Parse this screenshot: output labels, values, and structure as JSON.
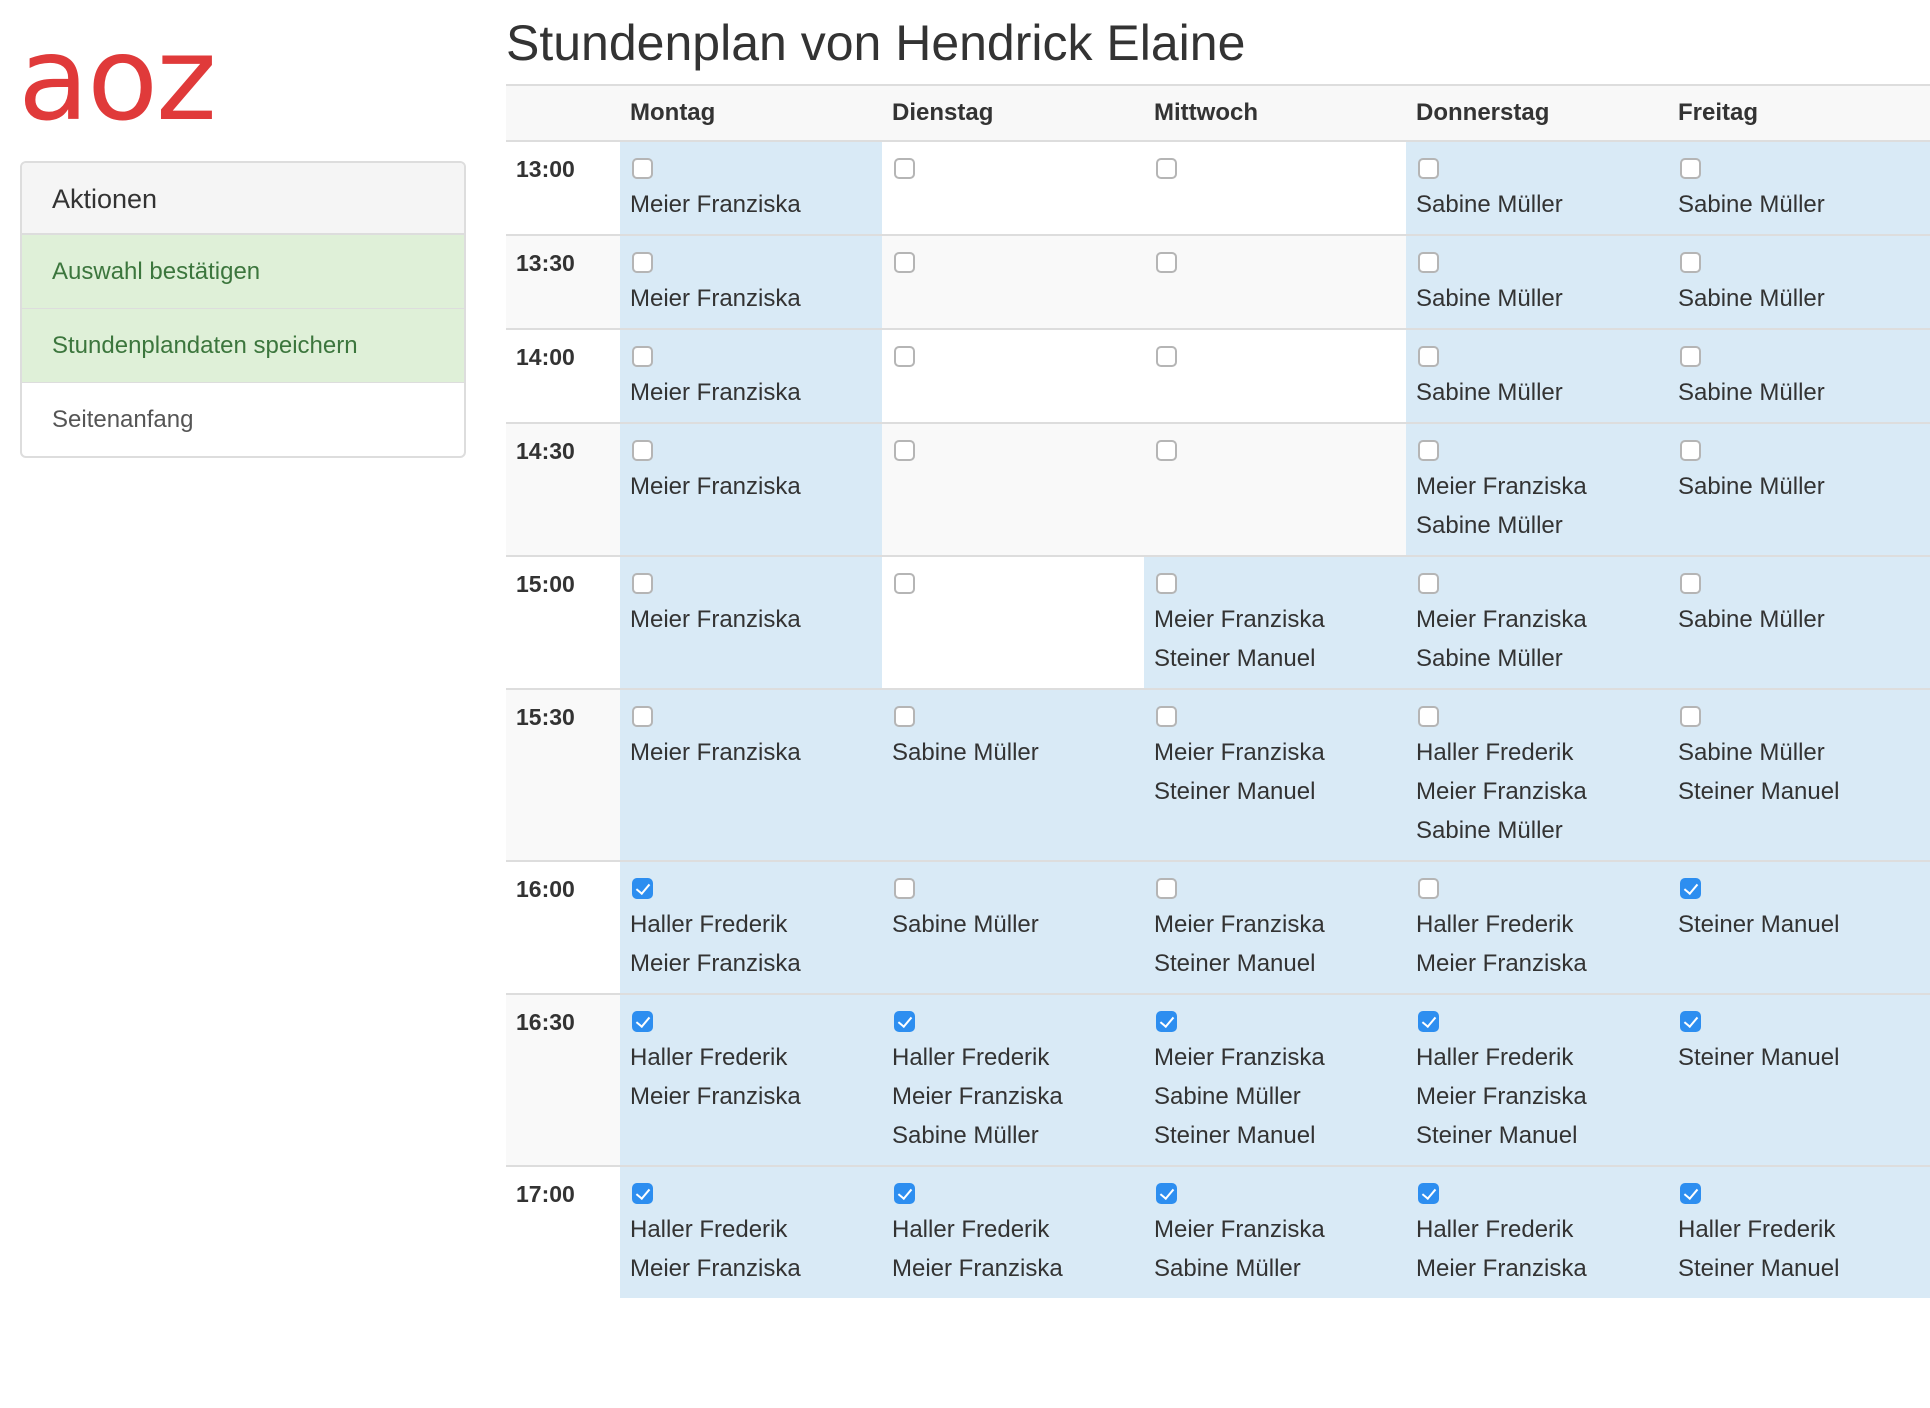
{
  "logo": "aoz",
  "title": "Stundenplan von Hendrick Elaine",
  "panel": {
    "heading": "Aktionen",
    "confirm": "Auswahl bestätigen",
    "save": "Stundenplandaten speichern",
    "top": "Seitenanfang"
  },
  "days": [
    "Montag",
    "Dienstag",
    "Mittwoch",
    "Donnerstag",
    "Freitag"
  ],
  "colors": {
    "available": "#d9eaf6",
    "checkbox_checked": "#2d8ef0",
    "logo": "#e03a3a",
    "action_green_bg": "#dff0d8",
    "action_green_text": "#3c763d"
  },
  "rows": [
    {
      "time": "13:00",
      "cells": [
        {
          "avail": true,
          "checked": false,
          "names": [
            "Meier Franziska"
          ]
        },
        {
          "avail": false,
          "checked": false,
          "names": []
        },
        {
          "avail": false,
          "checked": false,
          "names": []
        },
        {
          "avail": true,
          "checked": false,
          "names": [
            "Sabine Müller"
          ]
        },
        {
          "avail": true,
          "checked": false,
          "names": [
            "Sabine Müller"
          ]
        }
      ]
    },
    {
      "time": "13:30",
      "cells": [
        {
          "avail": true,
          "checked": false,
          "names": [
            "Meier Franziska"
          ]
        },
        {
          "avail": false,
          "checked": false,
          "names": []
        },
        {
          "avail": false,
          "checked": false,
          "names": []
        },
        {
          "avail": true,
          "checked": false,
          "names": [
            "Sabine Müller"
          ]
        },
        {
          "avail": true,
          "checked": false,
          "names": [
            "Sabine Müller"
          ]
        }
      ]
    },
    {
      "time": "14:00",
      "cells": [
        {
          "avail": true,
          "checked": false,
          "names": [
            "Meier Franziska"
          ]
        },
        {
          "avail": false,
          "checked": false,
          "names": []
        },
        {
          "avail": false,
          "checked": false,
          "names": []
        },
        {
          "avail": true,
          "checked": false,
          "names": [
            "Sabine Müller"
          ]
        },
        {
          "avail": true,
          "checked": false,
          "names": [
            "Sabine Müller"
          ]
        }
      ]
    },
    {
      "time": "14:30",
      "cells": [
        {
          "avail": true,
          "checked": false,
          "names": [
            "Meier Franziska"
          ]
        },
        {
          "avail": false,
          "checked": false,
          "names": []
        },
        {
          "avail": false,
          "checked": false,
          "names": []
        },
        {
          "avail": true,
          "checked": false,
          "names": [
            "Meier Franziska",
            "Sabine Müller"
          ]
        },
        {
          "avail": true,
          "checked": false,
          "names": [
            "Sabine Müller"
          ]
        }
      ]
    },
    {
      "time": "15:00",
      "cells": [
        {
          "avail": true,
          "checked": false,
          "names": [
            "Meier Franziska"
          ]
        },
        {
          "avail": false,
          "checked": false,
          "names": []
        },
        {
          "avail": true,
          "checked": false,
          "names": [
            "Meier Franziska",
            "Steiner Manuel"
          ]
        },
        {
          "avail": true,
          "checked": false,
          "names": [
            "Meier Franziska",
            "Sabine Müller"
          ]
        },
        {
          "avail": true,
          "checked": false,
          "names": [
            "Sabine Müller"
          ]
        }
      ]
    },
    {
      "time": "15:30",
      "cells": [
        {
          "avail": true,
          "checked": false,
          "names": [
            "Meier Franziska"
          ]
        },
        {
          "avail": true,
          "checked": false,
          "names": [
            "Sabine Müller"
          ]
        },
        {
          "avail": true,
          "checked": false,
          "names": [
            "Meier Franziska",
            "Steiner Manuel"
          ]
        },
        {
          "avail": true,
          "checked": false,
          "names": [
            "Haller Frederik",
            "Meier Franziska",
            "Sabine Müller"
          ]
        },
        {
          "avail": true,
          "checked": false,
          "names": [
            "Sabine Müller",
            "Steiner Manuel"
          ]
        }
      ]
    },
    {
      "time": "16:00",
      "cells": [
        {
          "avail": true,
          "checked": true,
          "names": [
            "Haller Frederik",
            "Meier Franziska"
          ]
        },
        {
          "avail": true,
          "checked": false,
          "names": [
            "Sabine Müller"
          ]
        },
        {
          "avail": true,
          "checked": false,
          "names": [
            "Meier Franziska",
            "Steiner Manuel"
          ]
        },
        {
          "avail": true,
          "checked": false,
          "names": [
            "Haller Frederik",
            "Meier Franziska"
          ]
        },
        {
          "avail": true,
          "checked": true,
          "names": [
            "Steiner Manuel"
          ]
        }
      ]
    },
    {
      "time": "16:30",
      "cells": [
        {
          "avail": true,
          "checked": true,
          "names": [
            "Haller Frederik",
            "Meier Franziska"
          ]
        },
        {
          "avail": true,
          "checked": true,
          "names": [
            "Haller Frederik",
            "Meier Franziska",
            "Sabine Müller"
          ]
        },
        {
          "avail": true,
          "checked": true,
          "names": [
            "Meier Franziska",
            "Sabine Müller",
            "Steiner Manuel"
          ]
        },
        {
          "avail": true,
          "checked": true,
          "names": [
            "Haller Frederik",
            "Meier Franziska",
            "Steiner Manuel"
          ]
        },
        {
          "avail": true,
          "checked": true,
          "names": [
            "Steiner Manuel"
          ]
        }
      ]
    },
    {
      "time": "17:00",
      "cells": [
        {
          "avail": true,
          "checked": true,
          "names": [
            "Haller Frederik",
            "Meier Franziska"
          ]
        },
        {
          "avail": true,
          "checked": true,
          "names": [
            "Haller Frederik",
            "Meier Franziska"
          ]
        },
        {
          "avail": true,
          "checked": true,
          "names": [
            "Meier Franziska",
            "Sabine Müller"
          ]
        },
        {
          "avail": true,
          "checked": true,
          "names": [
            "Haller Frederik",
            "Meier Franziska"
          ]
        },
        {
          "avail": true,
          "checked": true,
          "names": [
            "Haller Frederik",
            "Steiner Manuel"
          ]
        }
      ]
    }
  ]
}
